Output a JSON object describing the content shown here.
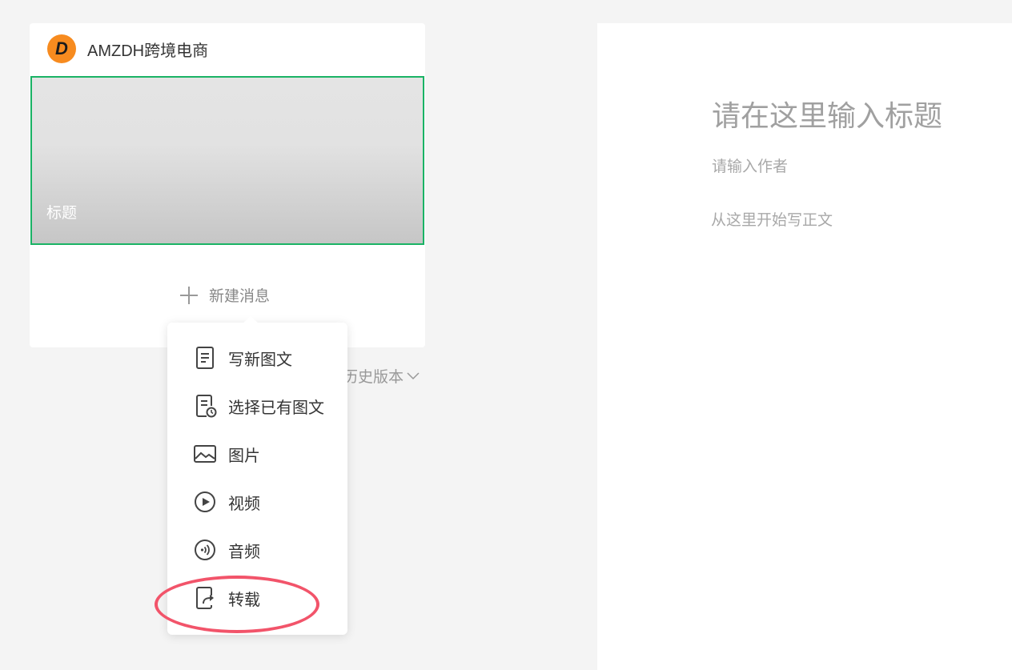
{
  "account": {
    "logo_letter": "D",
    "name": "AMZDH跨境电商"
  },
  "cover": {
    "title": "标题"
  },
  "new_message": {
    "label": "新建消息"
  },
  "history": {
    "label": "历史版本"
  },
  "menu": {
    "items": [
      {
        "label": "写新图文",
        "icon": "new-article-icon"
      },
      {
        "label": "选择已有图文",
        "icon": "existing-article-icon"
      },
      {
        "label": "图片",
        "icon": "image-icon"
      },
      {
        "label": "视频",
        "icon": "video-icon"
      },
      {
        "label": "音频",
        "icon": "audio-icon"
      },
      {
        "label": "转载",
        "icon": "repost-icon"
      }
    ]
  },
  "editor": {
    "title_placeholder": "请在这里输入标题",
    "author_placeholder": "请输入作者",
    "body_placeholder": "从这里开始写正文"
  },
  "colors": {
    "accent_green": "#1ab365",
    "logo_orange": "#f78b1f",
    "annotation_red": "#f2546a"
  }
}
